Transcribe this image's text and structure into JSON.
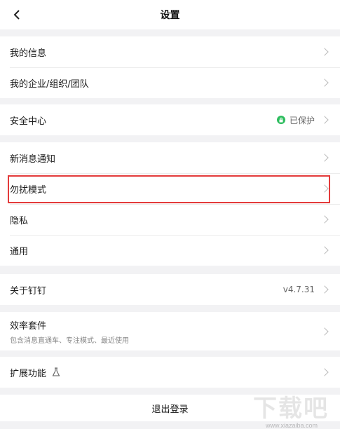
{
  "header": {
    "title": "设置"
  },
  "groups": [
    {
      "items": [
        {
          "label": "我的信息"
        },
        {
          "label": "我的企业/组织/团队"
        }
      ]
    },
    {
      "items": [
        {
          "label": "安全中心",
          "status": "已保护"
        }
      ]
    },
    {
      "items": [
        {
          "label": "新消息通知"
        },
        {
          "label": "勿扰模式"
        },
        {
          "label": "隐私"
        },
        {
          "label": "通用"
        }
      ]
    },
    {
      "items": [
        {
          "label": "关于钉钉",
          "value": "v4.7.31"
        }
      ]
    },
    {
      "items": [
        {
          "label": "效率套件",
          "subtitle": "包含消息直通车、专注模式、最近使用"
        }
      ]
    },
    {
      "items": [
        {
          "label": "扩展功能"
        }
      ]
    }
  ],
  "logout": {
    "label": "退出登录"
  },
  "watermark": {
    "text": "下载吧",
    "sub": "www.xiazaiba.com"
  },
  "icons": {
    "back": "back-chevron-icon",
    "chevron": "chevron-right-icon",
    "shield": "shield-check-icon",
    "flask": "flask-icon"
  },
  "colors": {
    "highlight": "#e33b3b",
    "shield": "#2dbd5e",
    "background": "#f2f2f4"
  }
}
